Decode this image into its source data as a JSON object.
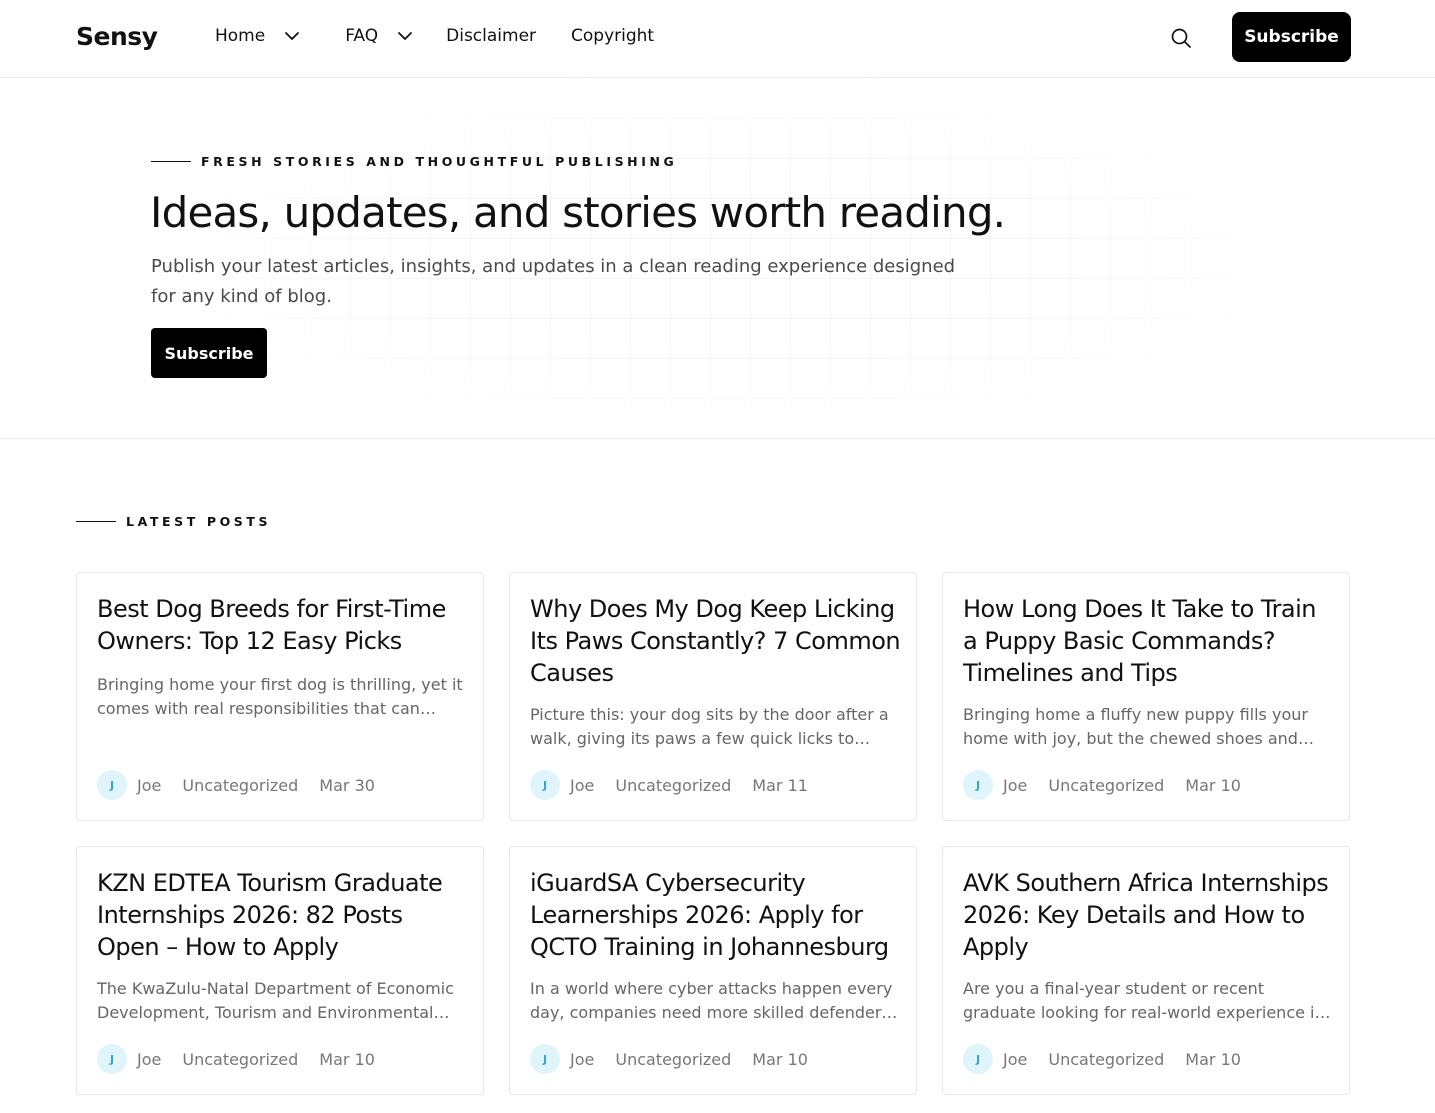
{
  "header": {
    "logo": "Sensy",
    "nav": {
      "home": "Home",
      "faq": "FAQ",
      "disclaimer": "Disclaimer",
      "copyright": "Copyright"
    },
    "subscribe_label": "Subscribe"
  },
  "hero": {
    "eyebrow": "FRESH STORIES AND THOUGHTFUL PUBLISHING",
    "title": "Ideas, updates, and stories worth reading.",
    "description": "Publish your latest articles, insights, and updates in a clean reading experience designed for any kind of blog.",
    "subscribe_label": "Subscribe"
  },
  "latest": {
    "label": "LATEST POSTS",
    "posts": [
      {
        "title": "Best Dog Breeds for First-Time Owners: Top 12 Easy Picks",
        "excerpt": "Bringing home your first dog is thrilling, yet it comes with real responsibilities that can shape your life for years.",
        "avatar_initial": "J",
        "author": "Joe",
        "category": "Uncategorized",
        "date": "Mar 30"
      },
      {
        "title": "Why Does My Dog Keep Licking Its Paws Constantly? 7 Common Causes",
        "excerpt": "Picture this: your dog sits by the door after a walk, giving its paws a few quick licks to clean them off.",
        "avatar_initial": "J",
        "author": "Joe",
        "category": "Uncategorized",
        "date": "Mar 11"
      },
      {
        "title": "How Long Does It Take to Train a Puppy Basic Commands? Timelines and Tips",
        "excerpt": "Bringing home a fluffy new puppy fills your home with joy, but the chewed shoes and accidents come fast.",
        "avatar_initial": "J",
        "author": "Joe",
        "category": "Uncategorized",
        "date": "Mar 10"
      },
      {
        "title": "KZN EDTEA Tourism Graduate Internships 2026: 82 Posts Open – How to Apply",
        "excerpt": "The KwaZulu-Natal Department of Economic Development, Tourism and Environmental Affairs is offering internships.",
        "avatar_initial": "J",
        "author": "Joe",
        "category": "Uncategorized",
        "date": "Mar 10"
      },
      {
        "title": "iGuardSA Cybersecurity Learnerships 2026: Apply for QCTO Training in Johannesburg",
        "excerpt": "In a world where cyber attacks happen every day, companies need more skilled defenders than ever before.",
        "avatar_initial": "J",
        "author": "Joe",
        "category": "Uncategorized",
        "date": "Mar 10"
      },
      {
        "title": "AVK Southern Africa Internships 2026: Key Details and How to Apply",
        "excerpt": "Are you a final-year student or recent graduate looking for real-world experience in business and engineering?",
        "avatar_initial": "J",
        "author": "Joe",
        "category": "Uncategorized",
        "date": "Mar 10"
      }
    ]
  },
  "icons": {
    "search": "search-icon",
    "chevron": "chevron-down-icon"
  },
  "colors": {
    "accent": "#000000",
    "avatar_bg": "#dff4fb",
    "avatar_fg": "#3aa3c9",
    "muted_text": "#666666",
    "border": "#e6e6e6"
  }
}
